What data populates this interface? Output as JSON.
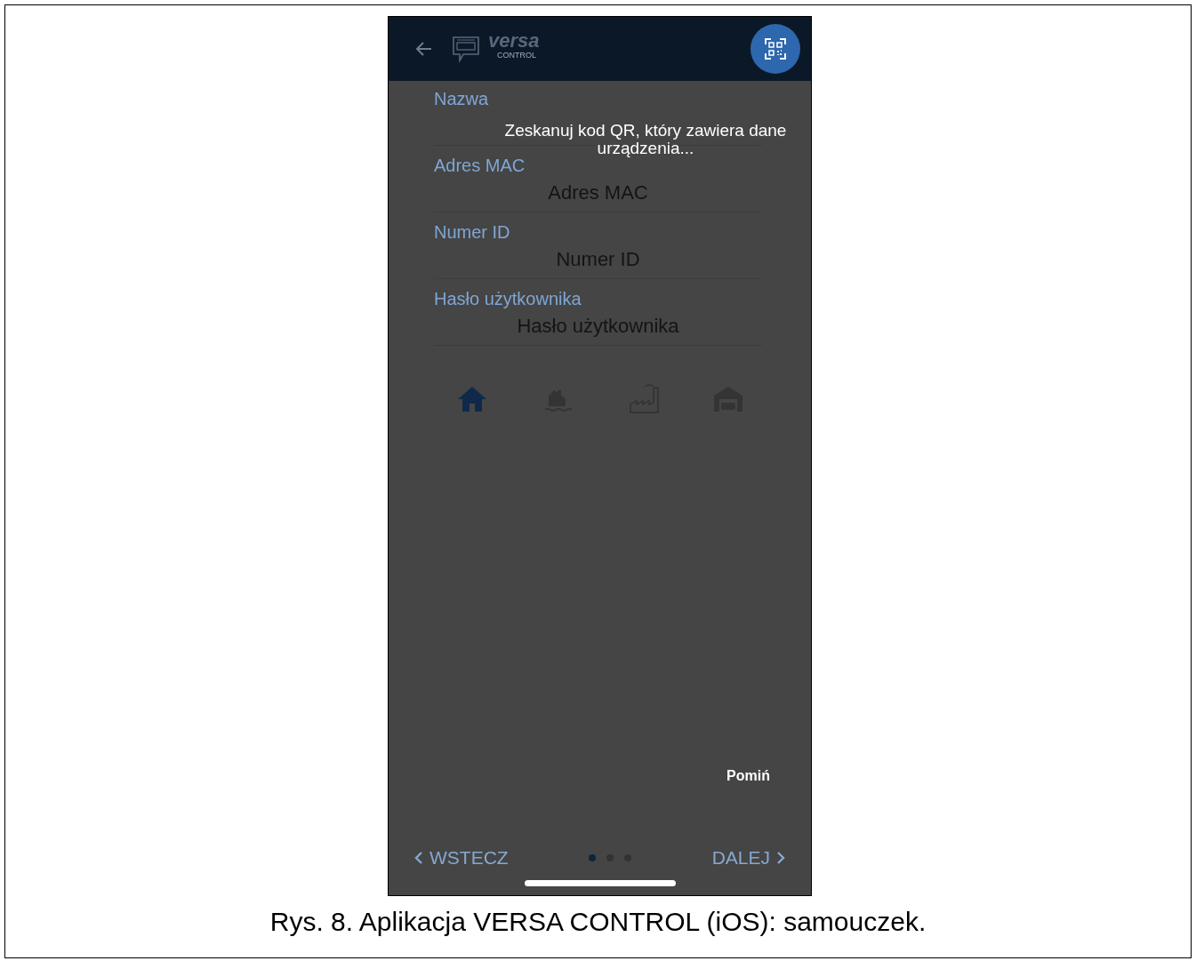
{
  "header": {
    "logo": {
      "title": "versa",
      "subtitle": "CONTROL"
    }
  },
  "fields": [
    {
      "label": "Nazwa"
    },
    {
      "label": "Adres MAC",
      "placeholder": "Adres MAC"
    },
    {
      "label": "Numer ID",
      "placeholder": "Numer ID"
    },
    {
      "label": "Hasło użytkownika",
      "placeholder": "Hasło użytkownika"
    }
  ],
  "building_types": [
    {
      "kind": "house",
      "selected": true
    },
    {
      "kind": "lakehouse",
      "selected": false
    },
    {
      "kind": "factory",
      "selected": false
    },
    {
      "kind": "garage",
      "selected": false
    }
  ],
  "tutorial_overlay": {
    "message": "Zeskanuj kod QR, który zawiera dane urządzenia...",
    "skip": "Pomiń"
  },
  "navigation": {
    "back": "WSTECZ",
    "next": "DALEJ",
    "pages": [
      {
        "selected": true
      },
      {
        "selected": false
      },
      {
        "selected": false
      }
    ]
  },
  "caption": "Rys. 8. Aplikacja VERSA CONTROL (iOS): samouczek."
}
